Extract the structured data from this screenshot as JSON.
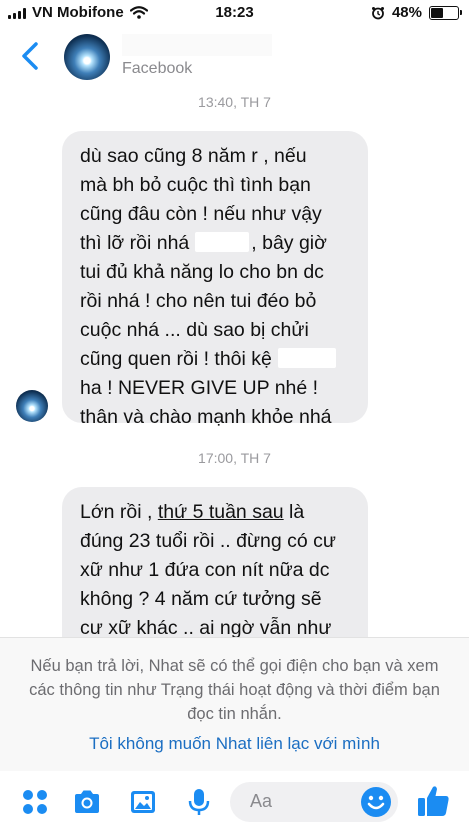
{
  "status_bar": {
    "carrier": "VN Mobifone",
    "time": "18:23",
    "battery": "48%",
    "battery_level": 0.48
  },
  "header": {
    "subtitle": "Facebook"
  },
  "messages": [
    {
      "timestamp": "13:40, TH 7",
      "lines": [
        "dù sao cũng 8 năm r , nếu",
        "mà bh bỏ cuộc thì tình bạn",
        "cũng đâu còn  ! nếu như vậy",
        [
          "thì lỡ rồi nhá",
          ", bây giờ"
        ],
        "tui đủ khả năng lo cho bn dc",
        "rồi nhá ! cho nên tui đéo bỏ",
        "cuộc nhá ... dù sao bị chửi",
        "cũng quen rồi ! thôi kệ",
        "ha ! NEVER GIVE UP nhé !",
        "thân và chào mạnh khỏe nhá"
      ]
    },
    {
      "timestamp": "17:00, TH 7",
      "lines": [
        [
          "Lớn rồi , ",
          "thứ 5 tuần sau",
          " là"
        ],
        "đúng 23 tuổi rồi .. đừng có cư",
        "xữ như 1 đứa con nít nữa dc",
        "không ? 4 năm cứ tưởng sẽ",
        "cư xữ khác .. ai ngờ vẫn như"
      ]
    }
  ],
  "notice": {
    "text": "Nếu bạn trả lời, Nhat sẽ có thể gọi điện cho bạn và xem các thông tin như Trạng thái hoạt động và thời điểm bạn đọc tin nhắn.",
    "link": "Tôi không muốn Nhat liên lạc với mình"
  },
  "composer": {
    "placeholder": "Aa",
    "icons": [
      "grid-icon",
      "camera-icon",
      "photo-icon",
      "microphone-icon",
      "emoji-icon",
      "thumbs-up-icon"
    ]
  },
  "colors": {
    "accent": "#1b8cf2",
    "bubble": "#ececee",
    "link": "#1b6ec2"
  }
}
